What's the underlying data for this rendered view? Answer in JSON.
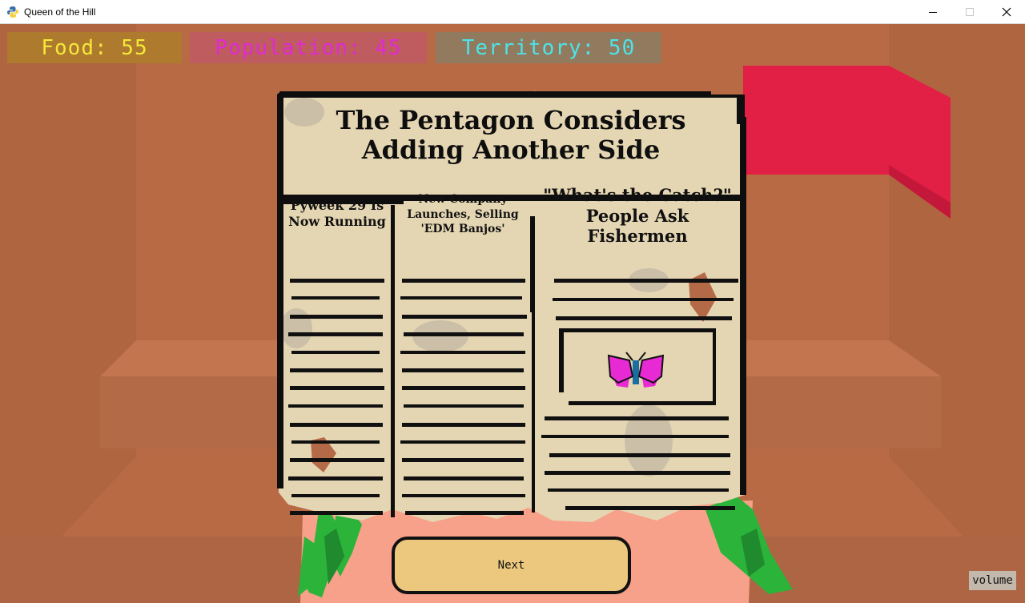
{
  "window": {
    "title": "Queen of the Hill",
    "controls": [
      "minimize",
      "maximize",
      "close"
    ]
  },
  "stats": {
    "food_label": "Food: 55",
    "population_label": "Population: 45",
    "territory_label": "Territory: 50",
    "colors": {
      "food_bg": "#ad7a2e",
      "food_text": "#f5e83a",
      "population_bg": "#bf5c5f",
      "population_text": "#e02ad4",
      "territory_bg": "#917a5e",
      "territory_text": "#4ce4e8"
    }
  },
  "newspaper": {
    "headline": "The Pentagon Considers Adding Another Side",
    "columns": [
      {
        "title": "Pyweek 29 Is Now Running"
      },
      {
        "title": "New Company Launches, Selling 'EDM Banjos'"
      },
      {
        "title": "\"What's the Catch?\" People Ask Fishermen"
      }
    ],
    "illustration": "butterfly-icon"
  },
  "buttons": {
    "next_label": "Next",
    "volume_label": "volume"
  },
  "scene": {
    "flag_color": "#e21f44",
    "floor_color": "#f7a08a",
    "paper_color": "#e5d6b3"
  }
}
